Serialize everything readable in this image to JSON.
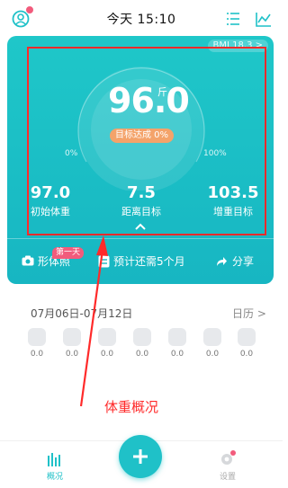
{
  "header": {
    "title": "今天 15:10"
  },
  "card": {
    "bmi": "BMI 18.3 >",
    "weight": "96.0",
    "unit": "斤",
    "goal_badge": "目标达成 0%",
    "pct_left": "0%",
    "pct_right": "100%",
    "stats": [
      {
        "value": "97.0",
        "label": "初始体重"
      },
      {
        "value": "7.5",
        "label": "距离目标"
      },
      {
        "value": "103.5",
        "label": "增重目标"
      }
    ],
    "actions": {
      "photo": "形体照",
      "badge": "第一天",
      "forecast": "预计还需5个月",
      "share": "分享"
    }
  },
  "week": {
    "range": "07月06日-07月12日",
    "calendar": "日历 >",
    "values": [
      "0.0",
      "0.0",
      "0.0",
      "0.0",
      "0.0",
      "0.0",
      "0.0"
    ]
  },
  "annotation": "体重概况",
  "tabs": {
    "overview": "概况",
    "settings": "设置"
  },
  "colors": {
    "teal": "#1fc1c8",
    "accent_red": "#ff2a2a",
    "orange": "#f4a36a",
    "pink": "#f25b7c"
  }
}
